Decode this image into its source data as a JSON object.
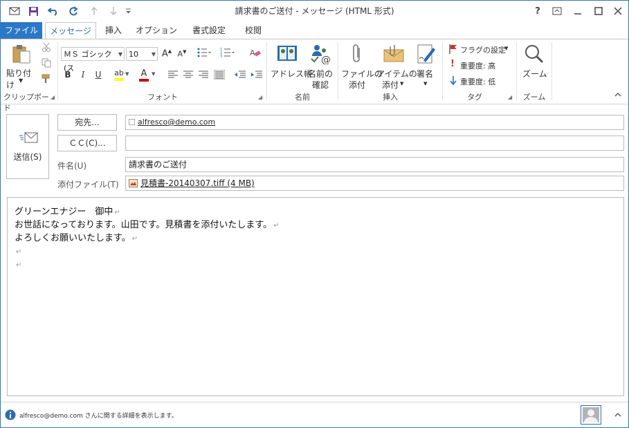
{
  "window": {
    "title": "請求書のご送付 - メッセージ (HTML 形式)",
    "help": "?"
  },
  "tabs": [
    {
      "label": "ファイル"
    },
    {
      "label": "メッセージ"
    },
    {
      "label": "挿入"
    },
    {
      "label": "オプション"
    },
    {
      "label": "書式設定"
    },
    {
      "label": "校閲"
    }
  ],
  "ribbon": {
    "clipboard": {
      "paste_label": "貼り付け",
      "group": "クリップボード"
    },
    "font": {
      "font_name": "ＭＳ ゴシック (ス",
      "font_size": "10",
      "group": "フォント",
      "bold": "B",
      "italic": "I",
      "underline": "U",
      "font_color_letter": "A",
      "highlight_letters": "ab"
    },
    "names": {
      "address_book": "アドレス帳",
      "check_names_line1": "名前の",
      "check_names_line2": "確認",
      "group": "名前"
    },
    "include": {
      "attach_file_line1": "ファイルの",
      "attach_file_line2": "添付",
      "attach_item_line1": "アイテムの",
      "attach_item_line2": "添付",
      "signature": "署名",
      "group": "挿入"
    },
    "tags": {
      "follow_up": "フラグの設定",
      "high_importance": "重要度: 高",
      "low_importance": "重要度: 低",
      "group": "タグ"
    },
    "zoom": {
      "label": "ズーム",
      "group": "ズーム"
    }
  },
  "form": {
    "send_label": "送信(S)",
    "to_button": "宛先...",
    "cc_button": "ＣＣ(C)...",
    "to_value": "alfresco@demo.com",
    "cc_value": "",
    "subject_label": "件名(U)",
    "subject_value": "請求書のご送付",
    "attachment_label": "添付ファイル(T)",
    "attachment_value": "見積書-20140307.tiff (4 MB)"
  },
  "body_lines": [
    "グリーンエナジー　御中",
    "お世話になっております。山田です。見積書を添付いたします。",
    "よろしくお願いいたします。",
    "",
    ""
  ],
  "status": {
    "info_text": "alfresco@demo.com さんに関する詳細を表示します。"
  },
  "colors": {
    "accent": "#2b79c6",
    "flag": "#c0392b",
    "importance_high": "#c0392b",
    "importance_low": "#2b6bb3"
  }
}
